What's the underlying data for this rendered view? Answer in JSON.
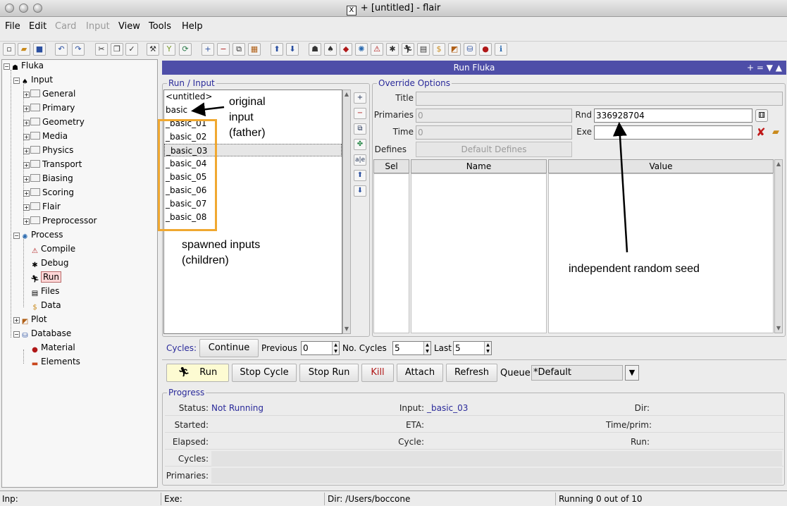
{
  "window": {
    "title": "+ [untitled] - flair",
    "x_label": "X"
  },
  "menu": [
    "File",
    "Edit",
    "Card",
    "Input",
    "View",
    "Tools",
    "Help"
  ],
  "menu_disabled": [
    false,
    false,
    true,
    true,
    false,
    false,
    false
  ],
  "tree": {
    "root": "Fluka",
    "input": "Input",
    "input_children": [
      "General",
      "Primary",
      "Geometry",
      "Media",
      "Physics",
      "Transport",
      "Biasing",
      "Scoring",
      "Flair",
      "Preprocessor"
    ],
    "process": "Process",
    "process_children": [
      "Compile",
      "Debug",
      "Run",
      "Files",
      "Data"
    ],
    "plot": "Plot",
    "database": "Database",
    "database_children": [
      "Material",
      "Elements"
    ]
  },
  "panel": {
    "title": "Run Fluka",
    "header_buttons": "+ = ▼ ▲"
  },
  "run_input": {
    "title": "Run / Input",
    "items": [
      "<untitled>",
      "basic",
      "_basic_01",
      "_basic_02",
      "_basic_03",
      "_basic_04",
      "_basic_05",
      "_basic_06",
      "_basic_07",
      "_basic_08"
    ],
    "selected": "_basic_03"
  },
  "override": {
    "title": "Override Options",
    "title_label": "Title",
    "primaries_label": "Primaries",
    "primaries_value": "0",
    "time_label": "Time",
    "time_value": "0",
    "rnd_label": "Rnd",
    "rnd_value": "336928704",
    "exe_label": "Exe",
    "exe_value": "",
    "defines_label": "Defines",
    "default_defines": "Default Defines",
    "columns": [
      "Sel",
      "Name",
      "Value"
    ]
  },
  "cycles": {
    "label": "Cycles:",
    "continue": "Continue",
    "previous_label": "Previous",
    "previous": "0",
    "no_cycles_label": "No. Cycles",
    "no_cycles": "5",
    "last_label": "Last",
    "last": "5"
  },
  "actions": {
    "run": "Run",
    "stop_cycle": "Stop Cycle",
    "stop_run": "Stop Run",
    "kill": "Kill",
    "attach": "Attach",
    "refresh": "Refresh",
    "queue_label": "Queue",
    "queue_value": "*Default"
  },
  "progress": {
    "title": "Progress",
    "status_label": "Status:",
    "status_value": "Not Running",
    "input_label": "Input:",
    "input_value": "_basic_03",
    "dir_label": "Dir:",
    "started_label": "Started:",
    "eta_label": "ETA:",
    "timeprim_label": "Time/prim:",
    "elapsed_label": "Elapsed:",
    "cycle_label": "Cycle:",
    "run_label": "Run:",
    "cycles_label": "Cycles:",
    "primaries_label": "Primaries:"
  },
  "statusbar": {
    "inp": "Inp:",
    "exe": "Exe:",
    "dir": "Dir: /Users/boccone",
    "running": "Running 0 out of 10"
  },
  "annotations": {
    "original_lines": [
      "original",
      "input",
      "(father)"
    ],
    "spawned_lines": [
      "spawned inputs",
      "(children)"
    ],
    "seed": "independent random seed"
  },
  "colors": {
    "header": "#4e4ea8",
    "group_title": "#2a2a9a",
    "highlight": "#f0a830",
    "kill": "#b01818"
  }
}
